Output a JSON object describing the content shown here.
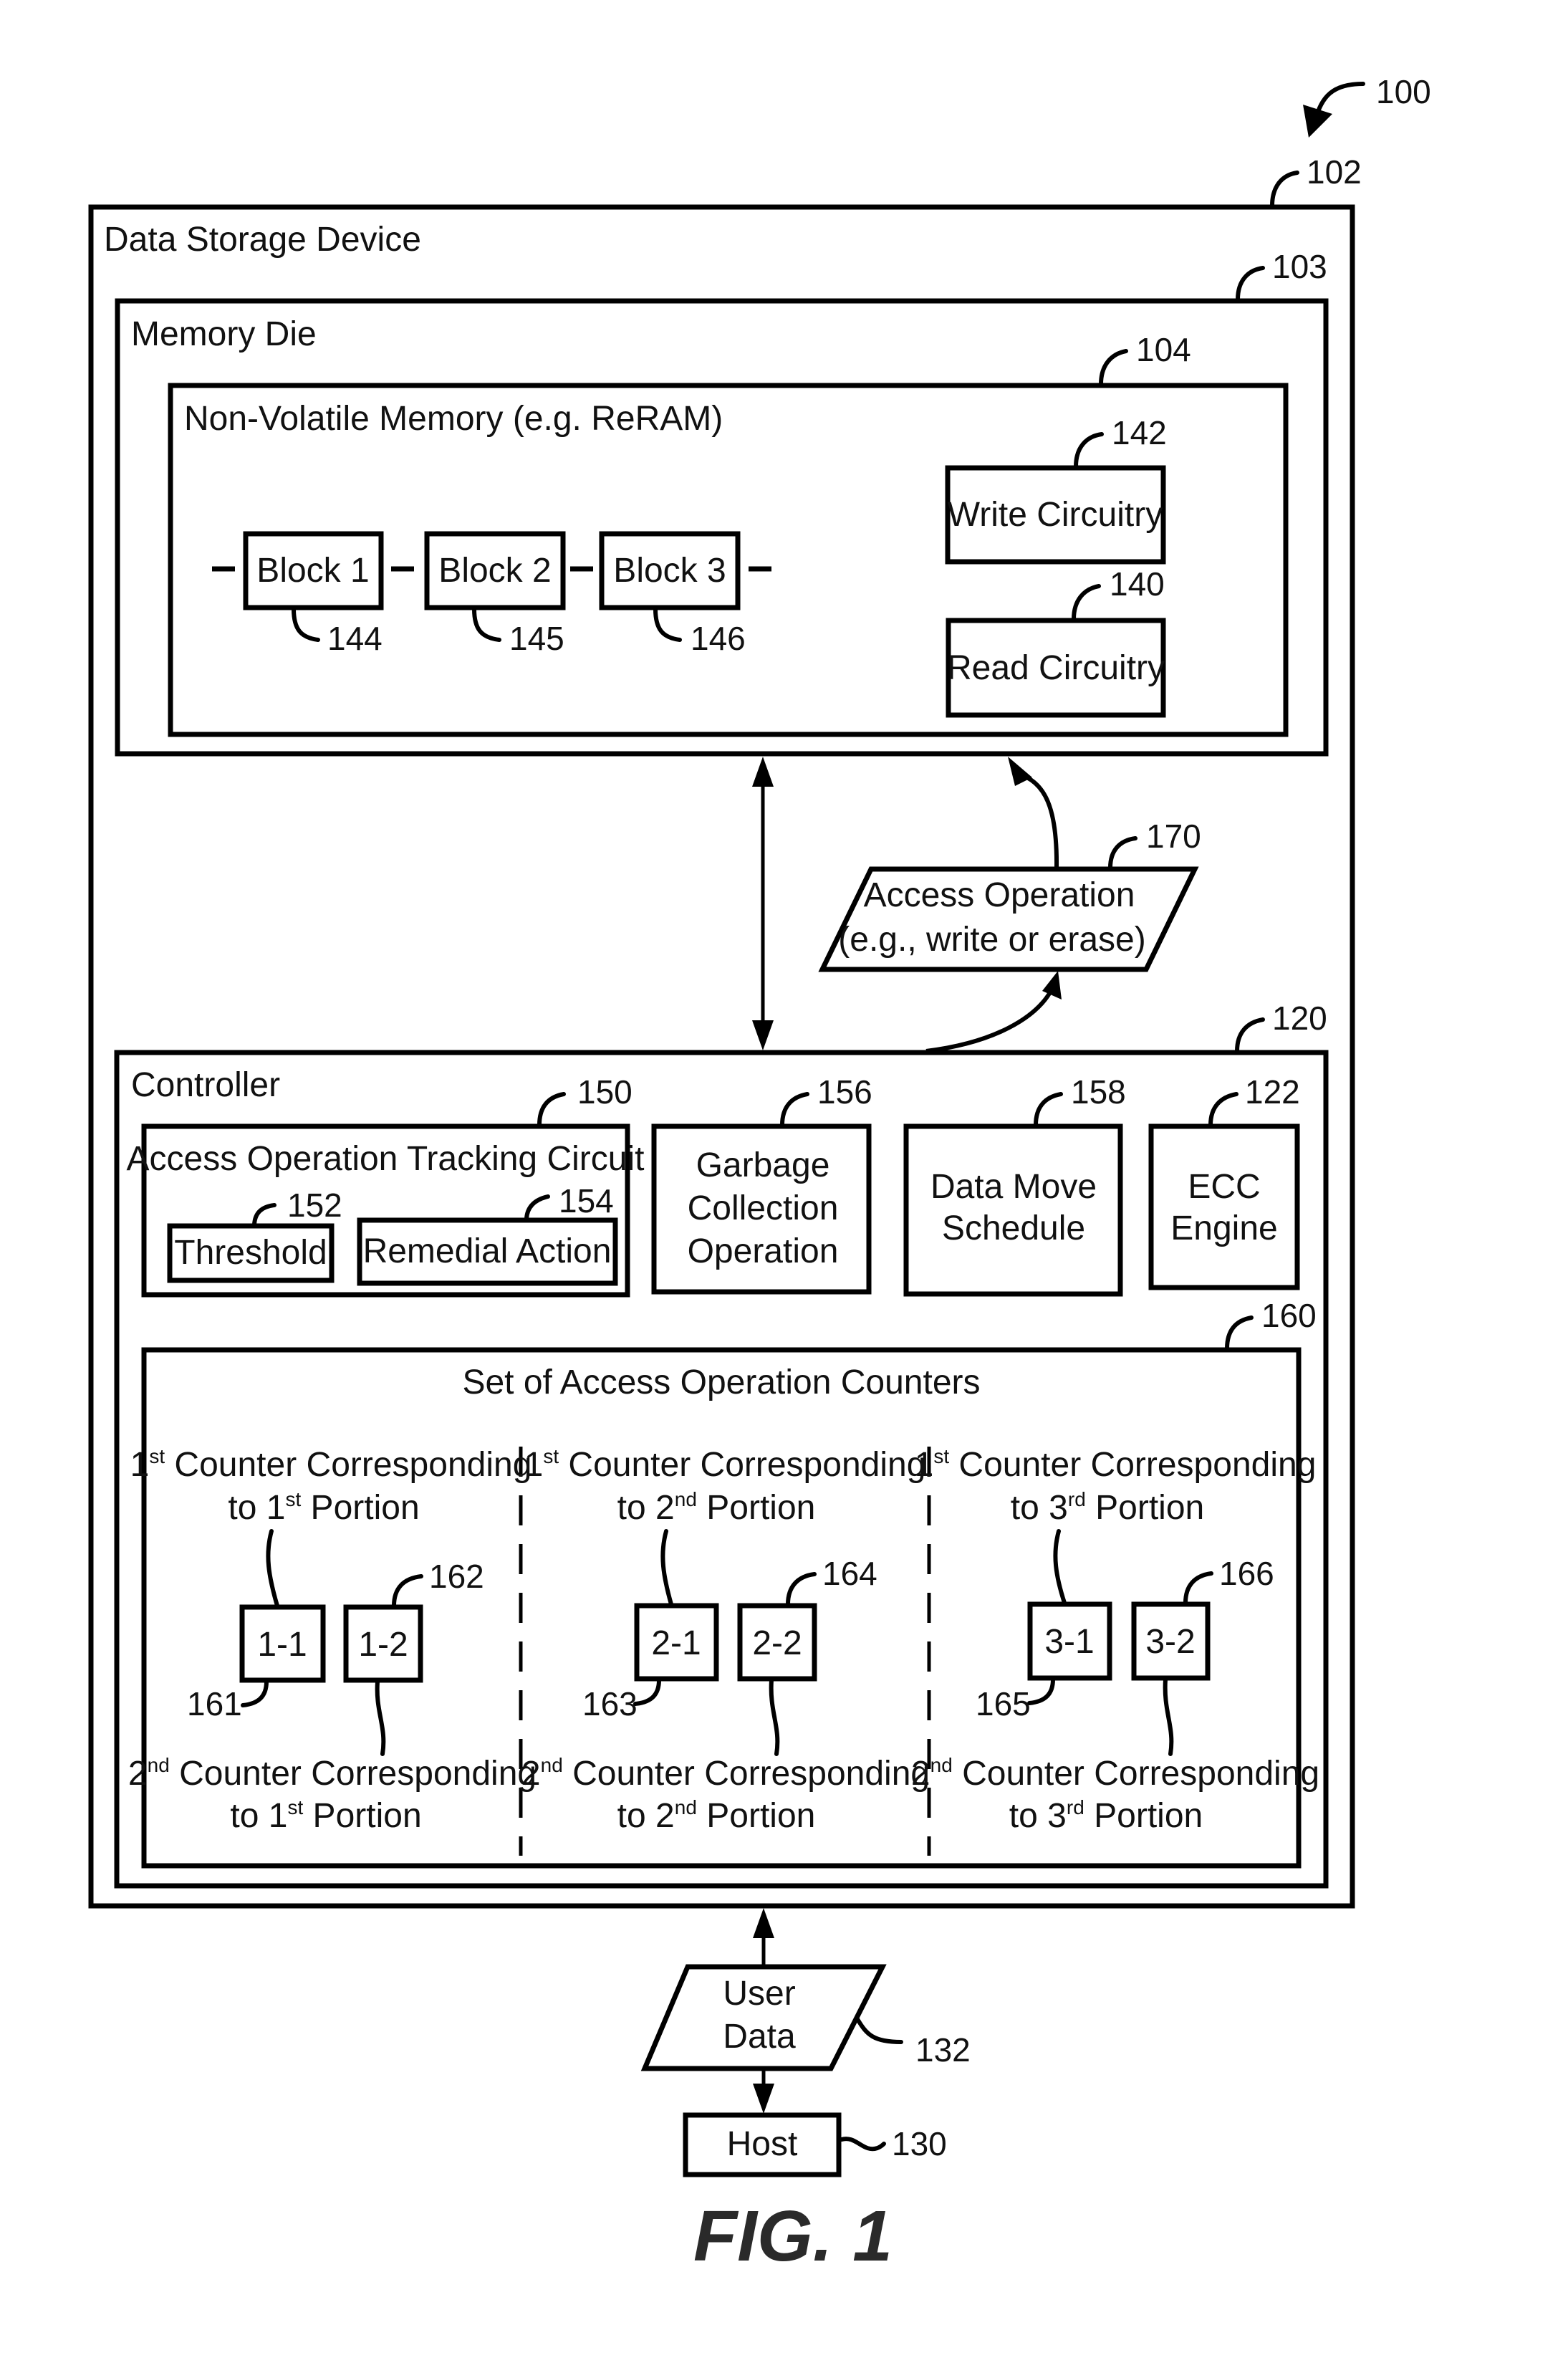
{
  "figure": {
    "label": "FIG. 1",
    "ref": "100"
  },
  "data_storage_device": {
    "title": "Data Storage Device",
    "ref": "102"
  },
  "memory_die": {
    "title": "Memory Die",
    "ref": "103",
    "non_volatile_memory": {
      "title": "Non-Volatile Memory (e.g. ReRAM)",
      "ref": "104",
      "blocks": [
        {
          "label": "Block 1",
          "ref": "144"
        },
        {
          "label": "Block 2",
          "ref": "145"
        },
        {
          "label": "Block 3",
          "ref": "146"
        }
      ],
      "write_circuitry": {
        "label": "Write Circuitry",
        "ref": "142"
      },
      "read_circuitry": {
        "label": "Read Circuitry",
        "ref": "140"
      }
    }
  },
  "access_operation": {
    "line1": "Access Operation",
    "line2": "(e.g., write or erase)",
    "ref": "170"
  },
  "controller": {
    "title": "Controller",
    "ref": "120",
    "tracking_circuit": {
      "title": "Access Operation Tracking Circuit",
      "ref": "150",
      "threshold": {
        "label": "Threshold",
        "ref": "152"
      },
      "remedial_action": {
        "label": "Remedial Action",
        "ref": "154"
      }
    },
    "garbage_collection": {
      "lines": [
        "Garbage",
        "Collection",
        "Operation"
      ],
      "ref": "156"
    },
    "data_move_schedule": {
      "lines": [
        "Data Move",
        "Schedule"
      ],
      "ref": "158"
    },
    "ecc_engine": {
      "lines": [
        "ECC",
        "Engine"
      ],
      "ref": "122"
    },
    "counters": {
      "title": "Set of Access Operation Counters",
      "ref": "160",
      "columns": [
        {
          "top": {
            "ord": "1",
            "sup": "st",
            "rest": " Counter Corresponding",
            "to": "to ",
            "ord2": "1",
            "sup2": "st",
            "portion": " Portion"
          },
          "bottom": {
            "ord": "2",
            "sup": "nd",
            "rest": " Counter Corresponding",
            "to": "to ",
            "ord2": "1",
            "sup2": "st",
            "portion": " Portion"
          },
          "counter_a": {
            "label": "1-1",
            "ref": "161"
          },
          "counter_b": {
            "label": "1-2",
            "ref": "162"
          }
        },
        {
          "top": {
            "ord": "1",
            "sup": "st",
            "rest": " Counter Corresponding",
            "to": "to ",
            "ord2": "2",
            "sup2": "nd",
            "portion": " Portion"
          },
          "bottom": {
            "ord": "2",
            "sup": "nd",
            "rest": " Counter Corresponding",
            "to": "to ",
            "ord2": "2",
            "sup2": "nd",
            "portion": " Portion"
          },
          "counter_a": {
            "label": "2-1",
            "ref": "163"
          },
          "counter_b": {
            "label": "2-2",
            "ref": "164"
          }
        },
        {
          "top": {
            "ord": "1",
            "sup": "st",
            "rest": " Counter Corresponding",
            "to": "to ",
            "ord2": "3",
            "sup2": "rd",
            "portion": " Portion"
          },
          "bottom": {
            "ord": "2",
            "sup": "nd",
            "rest": " Counter Corresponding",
            "to": "to ",
            "ord2": "3",
            "sup2": "rd",
            "portion": " Portion"
          },
          "counter_a": {
            "label": "3-1",
            "ref": "165"
          },
          "counter_b": {
            "label": "3-2",
            "ref": "166"
          }
        }
      ]
    }
  },
  "user_data": {
    "line1": "User",
    "line2": "Data",
    "ref": "132"
  },
  "host": {
    "label": "Host",
    "ref": "130"
  }
}
